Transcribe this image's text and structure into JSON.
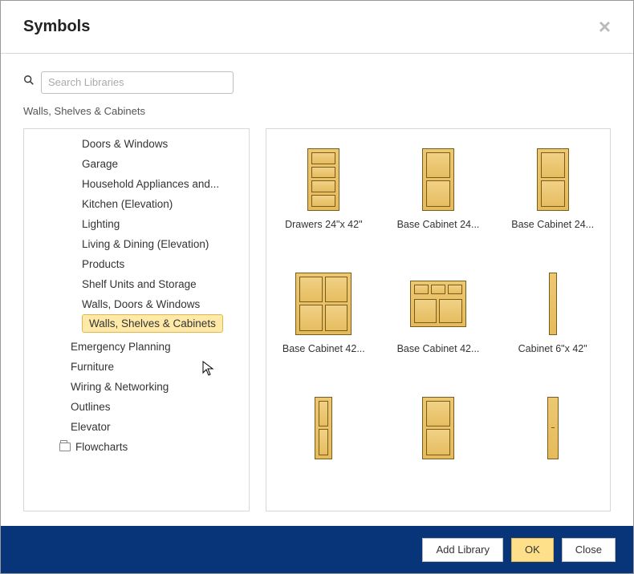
{
  "title": "Symbols",
  "search": {
    "placeholder": "Search Libraries"
  },
  "breadcrumb": "Walls, Shelves & Cabinets",
  "tree": {
    "items": [
      {
        "label": "Doors & Windows",
        "level": 2
      },
      {
        "label": "Garage",
        "level": 2
      },
      {
        "label": "Household Appliances and...",
        "level": 2
      },
      {
        "label": "Kitchen (Elevation)",
        "level": 2
      },
      {
        "label": "Lighting",
        "level": 2
      },
      {
        "label": "Living & Dining (Elevation)",
        "level": 2
      },
      {
        "label": "Products",
        "level": 2
      },
      {
        "label": "Shelf Units and Storage",
        "level": 2
      },
      {
        "label": "Walls, Doors & Windows",
        "level": 2
      },
      {
        "label": "Walls, Shelves & Cabinets",
        "level": 2,
        "selected": true
      },
      {
        "label": "Emergency Planning",
        "level": 1
      },
      {
        "label": "Furniture",
        "level": 1
      },
      {
        "label": "Wiring & Networking",
        "level": 1
      },
      {
        "label": "Outlines",
        "level": 1
      },
      {
        "label": "Elevator",
        "level": 1
      },
      {
        "label": "Flowcharts",
        "level": 0,
        "folder": true
      }
    ]
  },
  "gallery": [
    {
      "label": "Drawers 24\"x 42\"",
      "shape": "drawers"
    },
    {
      "label": "Base Cabinet 24...",
      "shape": "single"
    },
    {
      "label": "Base Cabinet 24...",
      "shape": "single"
    },
    {
      "label": "Base Cabinet 42...",
      "shape": "double"
    },
    {
      "label": "Base Cabinet 42...",
      "shape": "wide"
    },
    {
      "label": "Cabinet 6\"x 42\"",
      "shape": "slim"
    },
    {
      "label": "",
      "shape": "narrow"
    },
    {
      "label": "",
      "shape": "single"
    },
    {
      "label": "",
      "shape": "slim2"
    }
  ],
  "footer": {
    "add": "Add Library",
    "ok": "OK",
    "close": "Close"
  }
}
